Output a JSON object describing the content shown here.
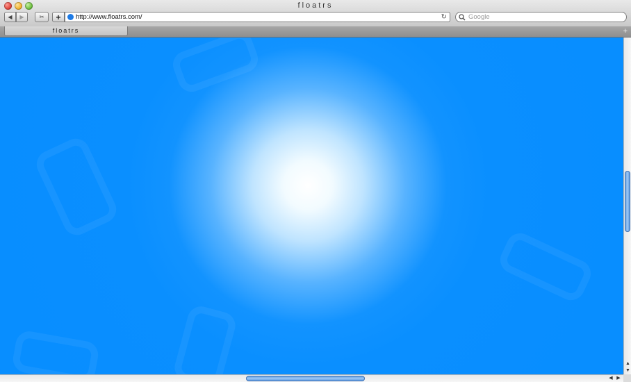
{
  "window": {
    "title": "floatrs"
  },
  "toolbar": {
    "back_icon": "◀",
    "forward_icon": "▶",
    "snippet_icon": "✂",
    "add_icon": "+",
    "url": "http://www.floatrs.com/",
    "reload_icon": "↻",
    "search_icon": "🔍",
    "search_placeholder": "Google"
  },
  "tabs": [
    {
      "label": "floatrs"
    }
  ],
  "new_tab_icon": "+",
  "colors": {
    "background_blue": "#078dff",
    "glow_center": "#ffffff",
    "scroll_thumb": "#6aa5e6"
  },
  "scrollbars": {
    "up_arrow": "▲",
    "down_arrow": "▼",
    "left_arrow": "◀",
    "right_arrow": "▶"
  }
}
